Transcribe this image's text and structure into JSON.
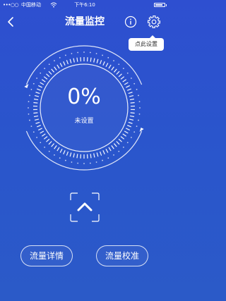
{
  "status_bar": {
    "signal": "•••○○",
    "carrier": "中国移动",
    "time": "下午6:10",
    "battery_level": 0.85
  },
  "header": {
    "title": "流量监控"
  },
  "tooltip": {
    "text": "点此设置"
  },
  "gauge": {
    "percent": "0%",
    "status": "未设置",
    "fill_fraction": 0
  },
  "buttons": {
    "details_label": "流量详情",
    "calibrate_label": "流量校准"
  },
  "icons": {
    "back": "chevron-left-icon",
    "info": "info-icon",
    "settings": "gear-icon",
    "expand": "chevron-up-icon",
    "wifi": "wifi-icon",
    "battery": "battery-icon"
  },
  "colors": {
    "background": "#2b52cc",
    "foreground": "#ffffff",
    "tooltip_text": "#333333"
  }
}
